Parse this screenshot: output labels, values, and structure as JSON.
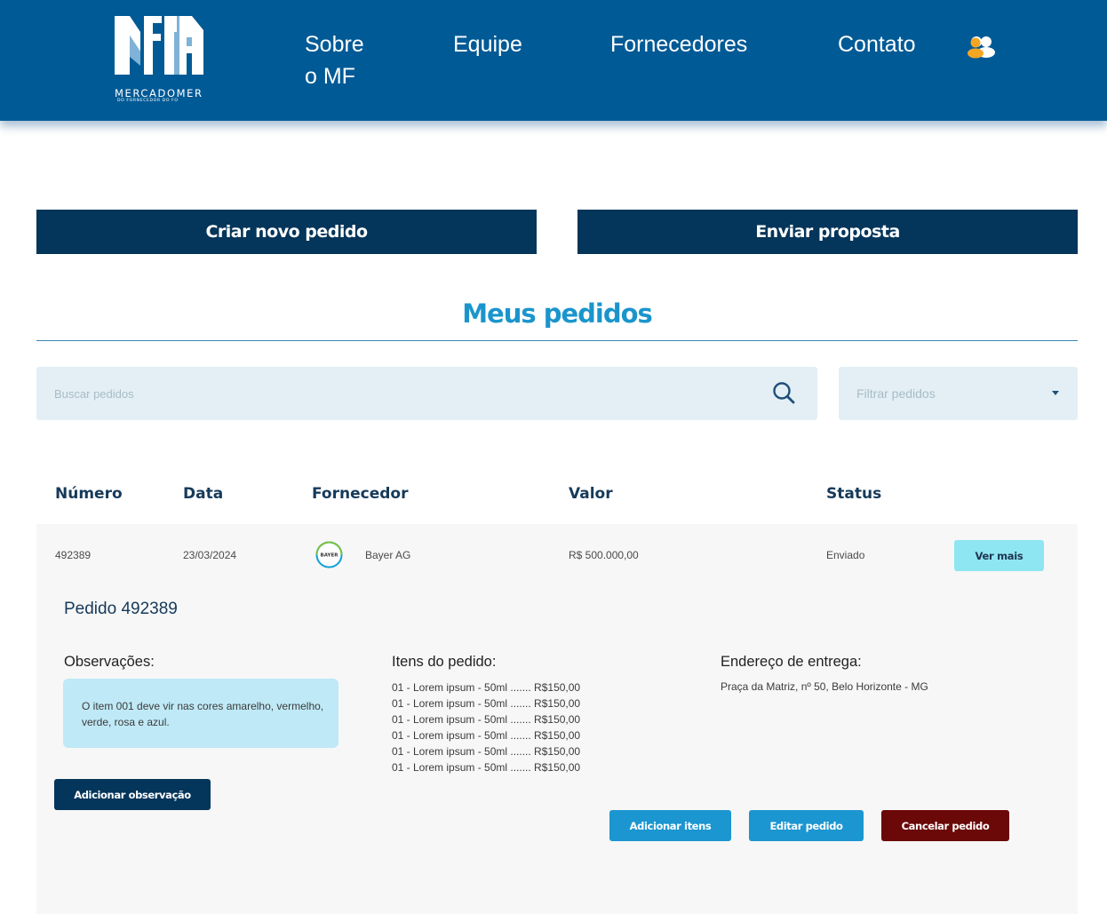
{
  "header": {
    "logo_text": "MERCADOMER",
    "logo_subtext": "DO FORNECEDOR  DO FO",
    "nav": [
      "Sobre o MF",
      "Equipe",
      "Fornecedores",
      "Contato"
    ],
    "user_icon": "users-icon"
  },
  "actions": {
    "create_order": "Criar novo pedido",
    "send_proposal": "Enviar proposta"
  },
  "section_title": "Meus pedidos",
  "search": {
    "placeholder": "Buscar pedidos"
  },
  "filter": {
    "placeholder": "Filtrar pedidos"
  },
  "table": {
    "headers": [
      "Número",
      "Data",
      "Fornecedor",
      "Valor",
      "Status"
    ],
    "rows": [
      {
        "number": "492389",
        "date": "23/03/2024",
        "supplier": "Bayer AG",
        "supplier_logo_text": "BAYER",
        "value": "R$ 500.000,00",
        "status": "Enviado",
        "action": "Ver mais"
      }
    ]
  },
  "order_detail": {
    "title": "Pedido 492389",
    "observations_label": "Observações:",
    "observation_text": "O item 001 deve vir nas cores amarelho, vermelho, verde, rosa e azul.",
    "items_label": "Itens do pedido:",
    "items": [
      "01 - Lorem ipsum - 50ml ....... R$150,00",
      "01 - Lorem ipsum - 50ml ....... R$150,00",
      "01 - Lorem ipsum - 50ml ....... R$150,00",
      "01 - Lorem ipsum - 50ml ....... R$150,00",
      "01 - Lorem ipsum - 50ml ....... R$150,00",
      "01 - Lorem ipsum - 50ml ....... R$150,00"
    ],
    "address_label": "Endereço de entrega:",
    "address": "Praça da Matriz, nº 50, Belo Horizonte - MG",
    "add_observation": "Adicionar observação",
    "add_items": "Adicionar itens",
    "edit_order": "Editar pedido",
    "cancel_order": "Cancelar pedido"
  },
  "colors": {
    "header_bg": "#005a96",
    "dark_button": "#04355a",
    "accent": "#1b96d0",
    "cancel": "#6b0808",
    "ver_mais": "#8ee6f2",
    "observation_bg": "#bfe9f6"
  }
}
